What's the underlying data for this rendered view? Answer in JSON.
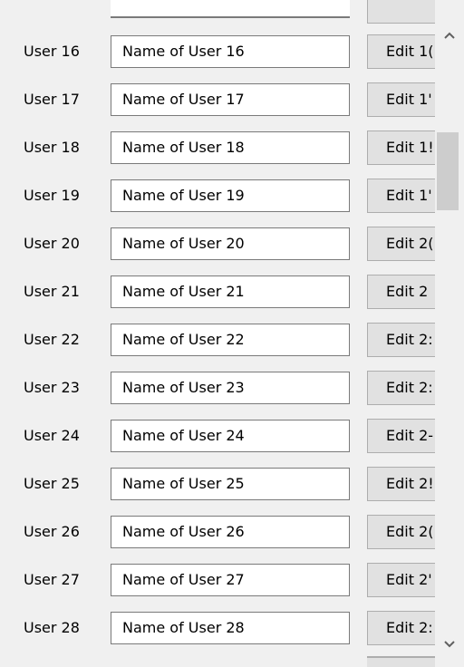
{
  "rows": [
    {
      "label": "User 16",
      "name": "Name of User 16",
      "button": "Edit 1("
    },
    {
      "label": "User 17",
      "name": "Name of User 17",
      "button": "Edit 1'"
    },
    {
      "label": "User 18",
      "name": "Name of User 18",
      "button": "Edit 1!"
    },
    {
      "label": "User 19",
      "name": "Name of User 19",
      "button": "Edit 1'"
    },
    {
      "label": "User 20",
      "name": "Name of User 20",
      "button": "Edit 2("
    },
    {
      "label": "User 21",
      "name": "Name of User 21",
      "button": "Edit 2"
    },
    {
      "label": "User 22",
      "name": "Name of User 22",
      "button": "Edit 2:"
    },
    {
      "label": "User 23",
      "name": "Name of User 23",
      "button": "Edit 2:"
    },
    {
      "label": "User 24",
      "name": "Name of User 24",
      "button": "Edit 2-"
    },
    {
      "label": "User 25",
      "name": "Name of User 25",
      "button": "Edit 2!"
    },
    {
      "label": "User 26",
      "name": "Name of User 26",
      "button": "Edit 2("
    },
    {
      "label": "User 27",
      "name": "Name of User 27",
      "button": "Edit 2'"
    },
    {
      "label": "User 28",
      "name": "Name of User 28",
      "button": "Edit 2:"
    }
  ],
  "scrollbar": {
    "up_icon": "chevron-up-icon",
    "down_icon": "chevron-down-icon"
  }
}
